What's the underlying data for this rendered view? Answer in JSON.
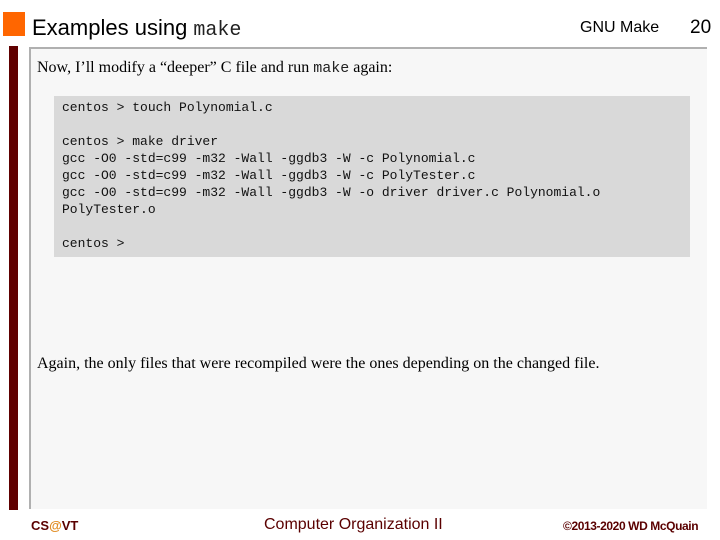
{
  "header": {
    "title_text": "Examples using ",
    "title_code": "make",
    "topic": "GNU Make",
    "page_number": "20"
  },
  "colors": {
    "accent_orange": "#ff6600",
    "maroon": "#600000",
    "footer_text": "#5a0000",
    "footer_at": "#e08a1e",
    "terminal_bg": "#d9d9d9",
    "panel_bg": "#f7f7f7"
  },
  "intro": {
    "before_code": "Now, I’ll modify a “deeper” C file and run ",
    "code": "make",
    "after_code": " again:"
  },
  "terminal": {
    "lines": [
      "centos > touch Polynomial.c",
      "",
      "centos > make driver",
      "gcc -O0 -std=c99 -m32 -Wall -ggdb3 -W -c Polynomial.c",
      "gcc -O0 -std=c99 -m32 -Wall -ggdb3 -W -c PolyTester.c",
      "gcc -O0 -std=c99 -m32 -Wall -ggdb3 -W -o driver driver.c Polynomial.o",
      "PolyTester.o",
      "",
      "centos >"
    ]
  },
  "conclusion": "Again, the only files that were recompiled were the ones depending on the changed file.",
  "footer": {
    "left_prefix": "CS",
    "left_at": "@",
    "left_suffix": "VT",
    "center": "Computer Organization II",
    "right": "©2013-2020 WD McQuain"
  }
}
